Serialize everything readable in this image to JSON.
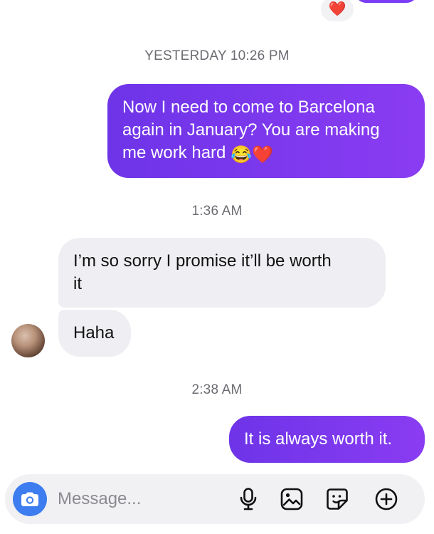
{
  "thread": {
    "top_reaction": "❤️",
    "timestamps": [
      "YESTERDAY 10:26 PM",
      "1:36 AM",
      "2:38 AM"
    ],
    "messages": {
      "m1": {
        "line1": "Now I need to come to Barcelona",
        "line2": "again in January? You are making",
        "line3_text": "me work hard ",
        "emoji1": "😂",
        "emoji2": "❤️"
      },
      "m2": {
        "line1": "I’m so sorry I promise it’ll be worth",
        "line2": "it"
      },
      "m3": {
        "text": "Haha"
      },
      "m4": {
        "text": "It is always worth it."
      }
    }
  },
  "composer": {
    "placeholder": "Message..."
  },
  "colors": {
    "outgoing_bubble_start": "#6e34e8",
    "outgoing_bubble_end": "#8a3cf2",
    "incoming_bubble": "#efeff3",
    "camera_button": "#3d7df0",
    "timestamp": "#6b6b72"
  },
  "icons": {
    "camera": "camera-icon",
    "mic": "microphone-icon",
    "image": "image-icon",
    "sticker": "sticker-icon",
    "plus": "plus-circle-icon"
  }
}
